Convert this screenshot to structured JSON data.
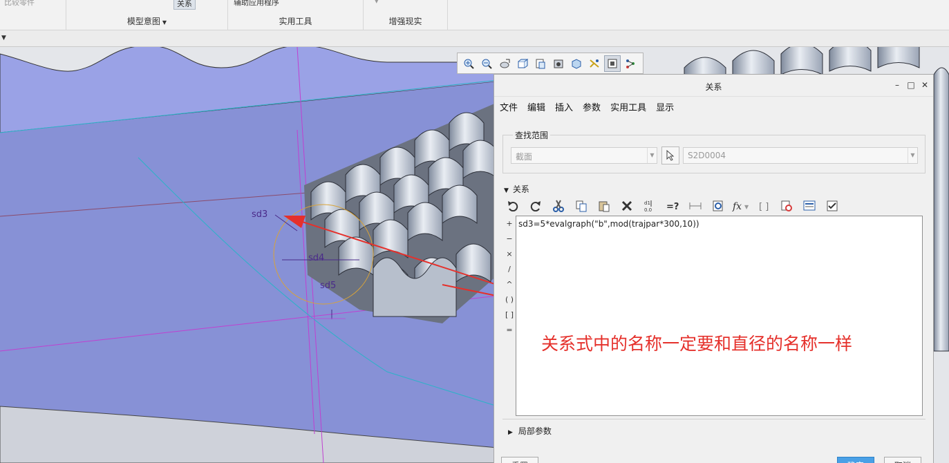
{
  "ribbon": {
    "top_items": {
      "compare_parts": "比较零件",
      "relations": "关系",
      "aux_apps": "辅助应用程序"
    },
    "groups": [
      {
        "label": "模型意图",
        "has_dropdown": true
      },
      {
        "label": "实用工具"
      },
      {
        "label": "增强现实"
      }
    ]
  },
  "viewport": {
    "dimension_labels": [
      "sd3",
      "sd4",
      "sd5"
    ],
    "accent_colors": {
      "plane": "#8d98dc",
      "arrow": "#e5302b",
      "circle": "#d9a338",
      "dim": "#4a2a8a"
    }
  },
  "view_toolbar": {
    "icons": [
      "zoom-in-icon",
      "zoom-out-icon",
      "refit-icon",
      "orient-icon",
      "saved-views-icon",
      "display-style-icon",
      "perspective-icon",
      "datum-display-icon",
      "annotation-display-icon",
      "spin-center-icon"
    ]
  },
  "dialog": {
    "title": "关系",
    "menu": [
      "文件",
      "编辑",
      "插入",
      "参数",
      "实用工具",
      "显示"
    ],
    "search": {
      "legend": "查找范围",
      "scope_value": "截面",
      "object_value": "S2D0004"
    },
    "section_label": "关系",
    "operators": [
      "+",
      "−",
      "×",
      "/",
      "^",
      "( )",
      "[ ]",
      "="
    ],
    "relation_text": "sd3=5*evalgraph(\"b\",mod(trajpar*300,10))",
    "local_params_label": "局部参数",
    "buttons": {
      "reset": "重置",
      "ok": "确定",
      "cancel": "取消"
    }
  },
  "annotation_text": "关系式中的名称一定要和直径的名称一样"
}
